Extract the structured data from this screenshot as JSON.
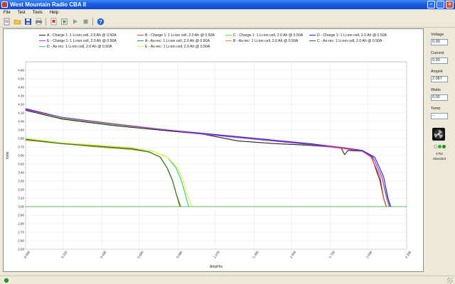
{
  "window": {
    "title": "West Mountain Radio CBA II",
    "min": "–",
    "max": "□",
    "close": "×"
  },
  "menu": [
    "File",
    "Test",
    "Tools",
    "Help"
  ],
  "toolbar": [
    "new-icon",
    "open-icon",
    "save-icon",
    "print-icon",
    "export-icon",
    "start-icon",
    "run-icon",
    "stop-icon",
    "help-icon"
  ],
  "legend": [
    {
      "label": "A - Charge 1: 1 Li-ion cell, 2.0 Ah @ 0.50A",
      "color": "#222222"
    },
    {
      "label": "B - Charge 1: 1 Li-ion cell, 2.0 Ah @ 0.50A",
      "color": "#e04040"
    },
    {
      "label": "C - Charge 1: 1 Li-ion cell, 2.0 Ah @ 0.50A",
      "color": "#66dd44"
    },
    {
      "label": "D - Charge 1: 1 Li-ion cell, 2.0 Ah @ 0.50A",
      "color": "#2222dd"
    },
    {
      "label": "E - Charge 1: 1 Li-ion cell, 2.0 Ah @ 0.50A",
      "color": "#aa33cc"
    },
    {
      "label": "A - As-rec: 1 Li-ion cell, 2.0 Ah @ 0.50A",
      "color": "#2b8c9c"
    },
    {
      "label": "B - As-rec: 1 Li-ion cell, 2.0 Ah @ 0.50A",
      "color": "#dd8822"
    },
    {
      "label": "C - As-rec: 1 Li-ion cell, 2.0 Ah @ 0.50A",
      "color": "#1e7a1e"
    },
    {
      "label": "D - As-rec: 1 Li-ion cell, 2.0 Ah @ 0.50A",
      "color": "#22cc99"
    },
    {
      "label": "E - As-rec: 1 Li-ion cell, 2.0 Ah @ 0.50A",
      "color": "#eeee33"
    }
  ],
  "side": {
    "voltage_label": "Voltage",
    "voltage_value": "0.00",
    "current_label": "Current",
    "current_value": "0.00",
    "amphr_label": "AmpHr",
    "amphr_value": "2.087",
    "watts_label": "Watts",
    "watts_value": "0.00",
    "temp_label": "Temp",
    "temp_value": "--",
    "unit_id": "4752",
    "mode": "Standard",
    "led_colors": [
      "#f2f2f2",
      "#2db52d",
      "#1f8f1f"
    ]
  },
  "chart_data": {
    "type": "line",
    "xlabel": "AmpHrs",
    "ylabel": "Volts",
    "xlim": [
      0.0,
      2.15
    ],
    "ylim": [
      2.5,
      4.7
    ],
    "x_ticks": [
      "0.000",
      "0.210",
      "0.430",
      "0.640",
      "0.860",
      "1.070",
      "1.290",
      "1.500",
      "1.720",
      "1.930",
      "2.150"
    ],
    "y_ticks": [
      "2.50",
      "2.60",
      "2.70",
      "2.80",
      "2.90",
      "3.00",
      "3.10",
      "3.20",
      "3.30",
      "3.40",
      "3.50",
      "3.60",
      "3.70",
      "3.80",
      "3.90",
      "4.00",
      "4.10",
      "4.20",
      "4.30",
      "4.40",
      "4.50",
      "4.60"
    ],
    "reference_line": 3.0,
    "series": [
      {
        "name": "A - Charge 1: 1 Li-ion cell, 2.0 Ah @ 0.50A",
        "color": "#222222",
        "x": [
          0.0,
          0.2,
          0.5,
          0.8,
          1.0,
          1.2,
          1.4,
          1.6,
          1.78,
          1.8,
          1.82,
          1.9,
          1.95,
          2.0,
          2.02,
          2.035
        ],
        "y": [
          4.13,
          4.03,
          3.95,
          3.89,
          3.85,
          3.77,
          3.74,
          3.72,
          3.69,
          3.61,
          3.66,
          3.65,
          3.6,
          3.3,
          3.1,
          3.0
        ]
      },
      {
        "name": "B - Charge 1: 1 Li-ion cell, 2.0 Ah @ 0.50A",
        "color": "#e04040",
        "x": [
          0.0,
          0.2,
          0.5,
          0.8,
          1.0,
          1.2,
          1.4,
          1.6,
          1.8,
          1.9,
          1.95,
          2.0,
          2.02,
          2.035
        ],
        "y": [
          4.14,
          4.04,
          3.96,
          3.9,
          3.85,
          3.81,
          3.77,
          3.73,
          3.68,
          3.65,
          3.58,
          3.35,
          3.1,
          3.0
        ]
      },
      {
        "name": "C - Charge 1: 1 Li-ion cell, 2.0 Ah @ 0.50A",
        "color": "#66dd44",
        "x": [
          0.0,
          0.2,
          0.5,
          0.8,
          1.0,
          1.2,
          1.4,
          1.6,
          1.8,
          1.9,
          1.96,
          2.01,
          2.035,
          2.05
        ],
        "y": [
          4.14,
          4.04,
          3.96,
          3.9,
          3.85,
          3.81,
          3.77,
          3.73,
          3.69,
          3.65,
          3.58,
          3.35,
          3.1,
          3.0
        ]
      },
      {
        "name": "D - Charge 1: 1 Li-ion cell, 2.0 Ah @ 0.50A",
        "color": "#2222dd",
        "x": [
          0.0,
          0.2,
          0.5,
          0.8,
          1.0,
          1.2,
          1.4,
          1.6,
          1.8,
          1.9,
          1.97,
          2.02,
          2.045,
          2.06
        ],
        "y": [
          4.15,
          4.05,
          3.97,
          3.9,
          3.86,
          3.82,
          3.78,
          3.74,
          3.69,
          3.66,
          3.58,
          3.35,
          3.1,
          3.0
        ]
      },
      {
        "name": "E - Charge 1: 1 Li-ion cell, 2.0 Ah @ 0.50A",
        "color": "#aa33cc",
        "x": [
          0.0,
          0.2,
          0.5,
          0.8,
          1.0,
          1.2,
          1.4,
          1.6,
          1.8,
          1.9,
          1.96,
          2.01,
          2.04,
          2.055
        ],
        "y": [
          4.14,
          4.05,
          3.97,
          3.9,
          3.85,
          3.81,
          3.77,
          3.73,
          3.69,
          3.65,
          3.58,
          3.35,
          3.1,
          3.0
        ]
      },
      {
        "name": "A - As-rec: 1 Li-ion cell, 2.0 Ah @ 0.50A",
        "color": "#2b8c9c",
        "x": [
          0.0,
          0.2,
          0.4,
          0.6,
          0.7,
          0.76,
          0.8,
          0.83,
          0.85,
          0.87
        ],
        "y": [
          3.79,
          3.74,
          3.71,
          3.68,
          3.64,
          3.58,
          3.45,
          3.3,
          3.15,
          3.0
        ]
      },
      {
        "name": "B - As-rec: 1 Li-ion cell, 2.0 Ah @ 0.50A",
        "color": "#dd8822",
        "x": [
          0.0,
          0.2,
          0.4,
          0.6,
          0.7,
          0.76,
          0.8,
          0.83,
          0.85,
          0.87
        ],
        "y": [
          3.78,
          3.74,
          3.7,
          3.67,
          3.64,
          3.58,
          3.45,
          3.3,
          3.15,
          3.0
        ]
      },
      {
        "name": "C - As-rec: 1 Li-ion cell, 2.0 Ah @ 0.50A",
        "color": "#1e7a1e",
        "x": [
          0.0,
          0.2,
          0.4,
          0.6,
          0.7,
          0.76,
          0.8,
          0.83,
          0.85,
          0.875
        ],
        "y": [
          3.79,
          3.74,
          3.71,
          3.68,
          3.64,
          3.58,
          3.45,
          3.3,
          3.15,
          3.0
        ]
      },
      {
        "name": "D - As-rec: 1 Li-ion cell, 2.0 Ah @ 0.50A",
        "color": "#22cc99",
        "x": [
          0.0,
          0.2,
          0.4,
          0.6,
          0.72,
          0.8,
          0.85,
          0.88,
          0.9,
          0.92
        ],
        "y": [
          3.8,
          3.75,
          3.72,
          3.69,
          3.65,
          3.58,
          3.45,
          3.3,
          3.15,
          3.0
        ]
      },
      {
        "name": "E - As-rec: 1 Li-ion cell, 2.0 Ah @ 0.50A",
        "color": "#eeee33",
        "x": [
          0.0,
          0.2,
          0.4,
          0.6,
          0.72,
          0.8,
          0.86,
          0.89,
          0.91,
          0.94
        ],
        "y": [
          3.8,
          3.75,
          3.72,
          3.69,
          3.65,
          3.58,
          3.45,
          3.3,
          3.15,
          3.0
        ]
      }
    ]
  }
}
